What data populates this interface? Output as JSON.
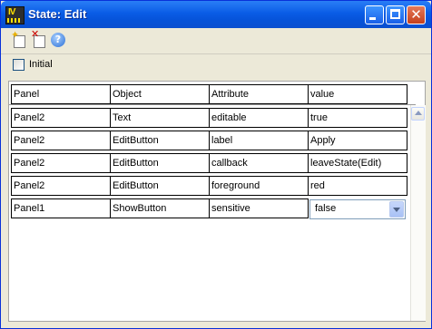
{
  "window": {
    "title": "State: Edit",
    "icon": "iv-app-icon"
  },
  "titlebar_buttons": {
    "minimize": "minimize-icon",
    "maximize": "maximize-icon",
    "close": "close-icon"
  },
  "toolbar": {
    "new": "new-icon",
    "delete": "delete-icon",
    "help": "help-icon",
    "help_glyph": "?"
  },
  "initial": {
    "label": "Initial",
    "checked": false
  },
  "table": {
    "headers": [
      "Panel",
      "Object",
      "Attribute",
      "value"
    ],
    "rows": [
      [
        "Panel2",
        "Text",
        "editable",
        "true"
      ],
      [
        "Panel2",
        "EditButton",
        "label",
        "Apply"
      ],
      [
        "Panel2",
        "EditButton",
        "callback",
        "leaveState(Edit)"
      ],
      [
        "Panel2",
        "EditButton",
        "foreground",
        "red"
      ],
      [
        "Panel1",
        "ShowButton",
        "sensitive",
        "false"
      ]
    ],
    "dropdown_value": "false"
  },
  "colors": {
    "titlebar": "#0a5ce6",
    "window_bg": "#ece9d8",
    "close_button": "#c5401c"
  }
}
